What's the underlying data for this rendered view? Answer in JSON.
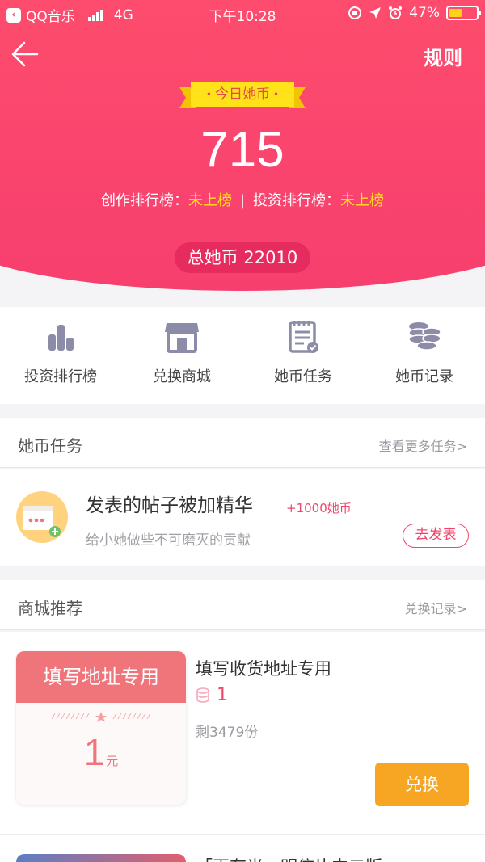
{
  "status_bar": {
    "carrier": "QQ音乐",
    "network": "4G",
    "time": "下午10:28",
    "battery": "47%",
    "battery_level": 0.47
  },
  "header": {
    "rules_label": "规则",
    "today_label": "今日她币",
    "today_value": "715",
    "creation_rank_label": "创作排行榜：",
    "creation_rank_value": "未上榜",
    "separator": "|",
    "invest_rank_label": "投资排行榜：",
    "invest_rank_value": "未上榜",
    "total_label": "总她币 22010"
  },
  "quick_entries": [
    {
      "label": "投资排行榜",
      "icon": "bar-chart-icon"
    },
    {
      "label": "兑换商城",
      "icon": "store-icon"
    },
    {
      "label": "她币任务",
      "icon": "task-list-icon"
    },
    {
      "label": "她币记录",
      "icon": "coins-icon"
    }
  ],
  "tasks_section": {
    "title": "她币任务",
    "more": "查看更多任务>",
    "task": {
      "title": "发表的帖子被加精华",
      "reward": "+1000她币",
      "description": "给小她做些不可磨灭的贡献",
      "action": "去发表"
    }
  },
  "mall_section": {
    "title": "商城推荐",
    "more": "兑换记录>",
    "product": {
      "coupon_title": "填写地址专用",
      "coupon_price": "1",
      "coupon_unit": "元",
      "name": "填写收货地址专用",
      "cost": "1",
      "remaining": "剩3479份",
      "action": "兑换"
    },
    "next_product_title": "「再有光」明信片中元版"
  },
  "colors": {
    "brand_pink": "#fe4e6d",
    "highlight_yellow": "#ffe21a",
    "button_orange": "#f6a623"
  }
}
